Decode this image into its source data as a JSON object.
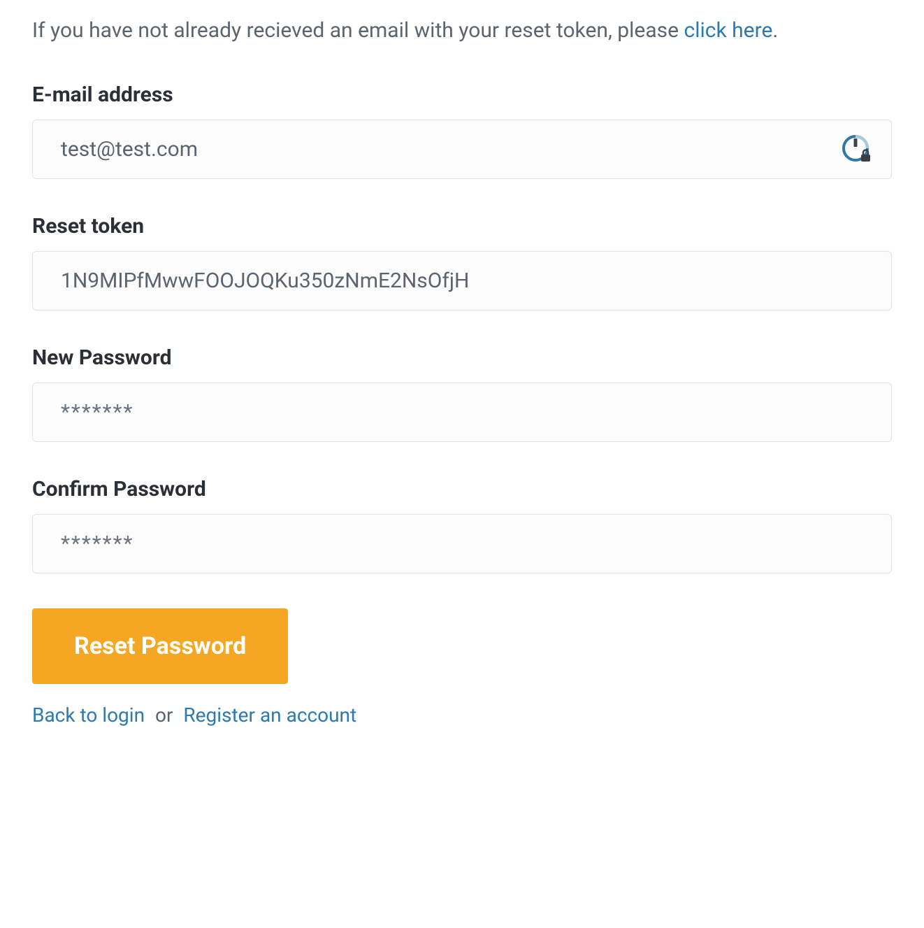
{
  "intro": {
    "prefix": "If you have not already recieved an email with your reset token, please ",
    "link_text": "click here",
    "suffix": "."
  },
  "form": {
    "email": {
      "label": "E-mail address",
      "value": "test@test.com"
    },
    "token": {
      "label": "Reset token",
      "value": "1N9MIPfMwwFOOJOQKu350zNmE2NsOfjH"
    },
    "new_password": {
      "label": "New Password",
      "placeholder": "*******"
    },
    "confirm_password": {
      "label": "Confirm Password",
      "placeholder": "*******"
    },
    "submit_label": "Reset Password"
  },
  "footer": {
    "back_label": "Back to login",
    "separator": "or",
    "register_label": "Register an account"
  }
}
